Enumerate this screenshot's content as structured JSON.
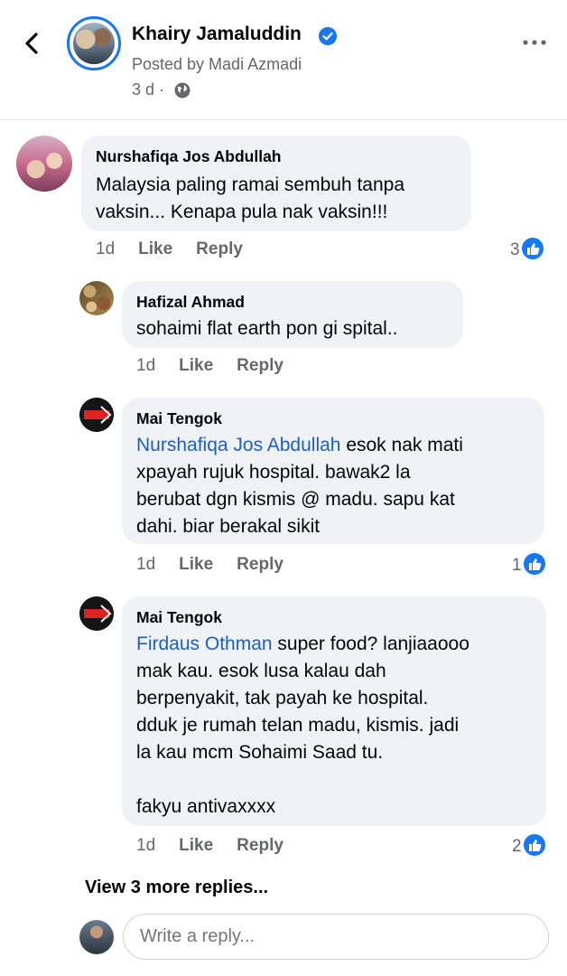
{
  "header": {
    "page_name": "Khairy Jamaluddin",
    "posted_by": "Posted by Madi Azmadi",
    "time": "3 d ·",
    "icons": [
      "back-arrow-icon",
      "verified-badge-icon",
      "globe-icon",
      "more-options-icon"
    ]
  },
  "comments": [
    {
      "author": "Nurshafiqa Jos Abdullah",
      "text": "Malaysia paling ramai sembuh tanpa\nvaksin... Kenapa pula nak vaksin!!!",
      "time": "1d",
      "like": "Like",
      "reply": "Reply",
      "likes": "3"
    },
    {
      "author": "Hafizal Ahmad",
      "text": "sohaimi flat earth pon gi spital..",
      "time": "1d",
      "like": "Like",
      "reply": "Reply"
    },
    {
      "author": "Mai Tengok",
      "mention": "Nurshafiqa Jos Abdullah",
      "text": "  esok nak mati\nxpayah rujuk hospital. bawak2 la\nberubat dgn kismis @ madu. sapu kat\ndahi. biar berakal sikit",
      "time": "1d",
      "like": "Like",
      "reply": "Reply",
      "likes": "1"
    },
    {
      "author": "Mai Tengok",
      "mention": "Firdaus Othman",
      "text": "  super food? lanjiaaooo\nmak kau. esok lusa kalau dah\nberpenyakit, tak payah ke hospital.\ndduk je rumah telan madu, kismis. jadi\nla kau mcm Sohaimi Saad tu.\n\nfakyu antivaxxxx",
      "time": "1d",
      "like": "Like",
      "reply": "Reply",
      "likes": "2"
    }
  ],
  "view_more": "View 3 more replies...",
  "reply_box": {
    "placeholder": "Write a reply..."
  },
  "colors": {
    "accent": "#1877f2",
    "bubble": "#f0f2f5",
    "mention": "#1b5fc4",
    "meta": "#65676b"
  }
}
